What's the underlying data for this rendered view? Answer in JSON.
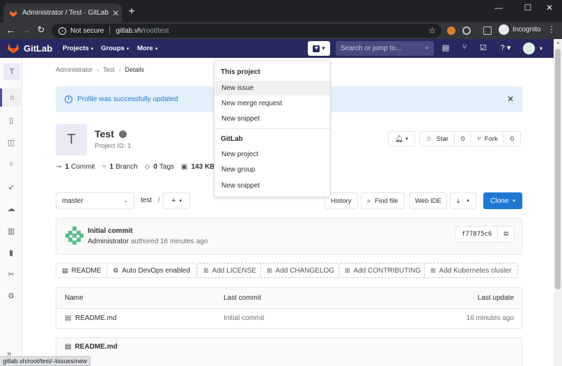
{
  "browser": {
    "tab_title": "Administrator / Test · GitLab",
    "url_security": "Not secure",
    "url_host": "gitlab.vh",
    "url_path": "/root/test",
    "profile_label": "Incognito",
    "status_url": "gitlab.vh/root/test/-/issues/new"
  },
  "header": {
    "brand": "GitLab",
    "nav": [
      "Projects",
      "Groups",
      "More"
    ],
    "search_placeholder": "Search or jump to..."
  },
  "sidebar": {
    "project_initial": "T",
    "items": [
      "project-overview",
      "repository",
      "issues",
      "merge-requests",
      "ci-cd",
      "operations",
      "analytics",
      "wiki",
      "snippets",
      "settings"
    ]
  },
  "breadcrumb": [
    "Administrator",
    "Test",
    "Details"
  ],
  "flash": {
    "message": "Profile was successfully updated"
  },
  "project": {
    "initial": "T",
    "name": "Test",
    "id_label": "Project ID: 1",
    "star_label": "Star",
    "star_count": "0",
    "fork_label": "Fork",
    "fork_count": "0"
  },
  "stats": {
    "commits_count": "1",
    "commits_label": "Commit",
    "branches_count": "1",
    "branches_label": "Branch",
    "tags_count": "0",
    "tags_label": "Tags",
    "size": "143 KB"
  },
  "repo_bar": {
    "branch": "master",
    "path": "test",
    "path_sep": "/",
    "history": "History",
    "find_file": "Find file",
    "web_ide": "Web IDE",
    "clone": "Clone"
  },
  "last_commit": {
    "message": "Initial commit",
    "author": "Administrator",
    "meta": "authored 16 minutes ago",
    "sha": "f77875c6"
  },
  "quick_buttons": [
    "README",
    "Auto DevOps enabled",
    "Add LICENSE",
    "Add CHANGELOG",
    "Add CONTRIBUTING",
    "Add Kubernetes cluster"
  ],
  "file_table": {
    "headers": [
      "Name",
      "Last commit",
      "Last update"
    ],
    "rows": [
      {
        "name": "README.md",
        "commit": "Initial commit",
        "updated": "16 minutes ago"
      }
    ]
  },
  "readme_title": "README.md",
  "new_dropdown": {
    "section1": "This project",
    "items1": [
      "New issue",
      "New merge request",
      "New snippet"
    ],
    "section2": "GitLab",
    "items2": [
      "New project",
      "New group",
      "New snippet"
    ]
  },
  "colors": {
    "header_bg": "#292961",
    "accent_blue": "#1f78d1",
    "flash_bg": "#e2f0fa"
  }
}
